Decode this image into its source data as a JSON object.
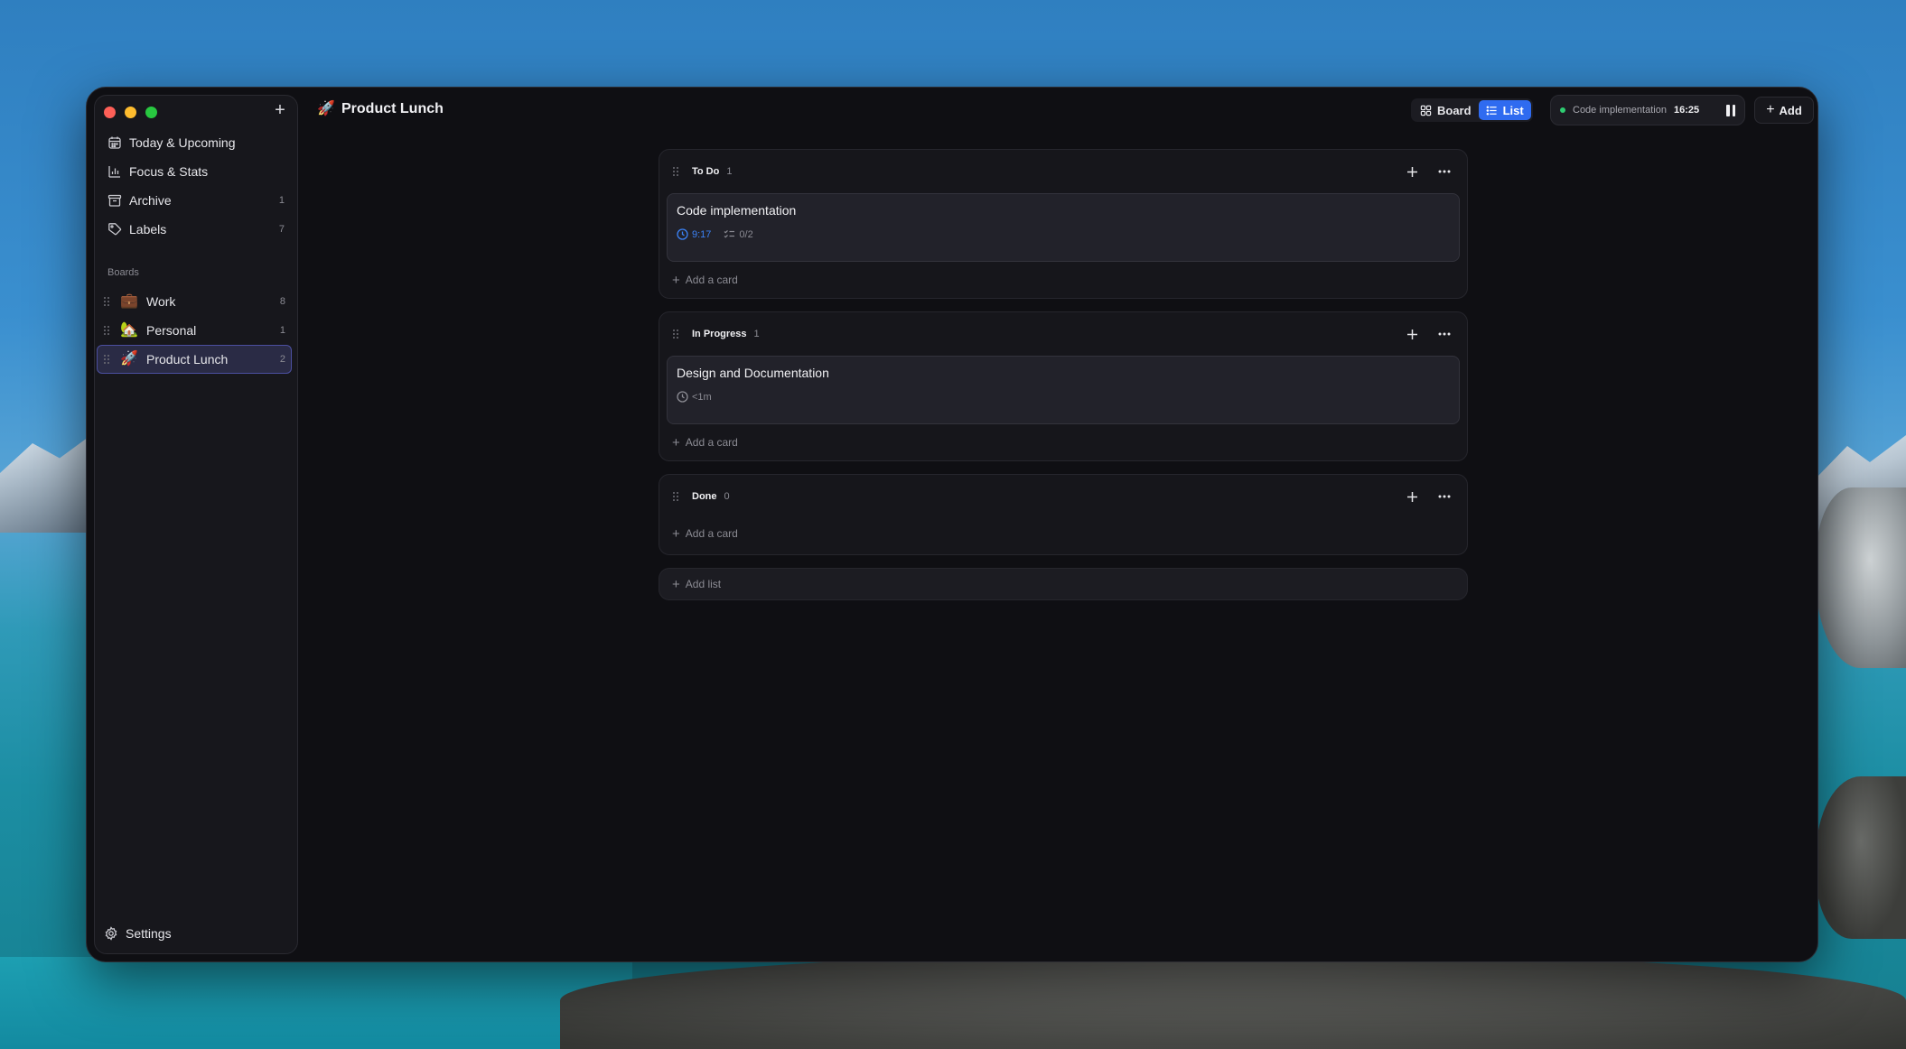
{
  "window": {
    "title": "Product Lunch",
    "title_emoji": "🚀"
  },
  "sidebar": {
    "nav": [
      {
        "label": "Today & Upcoming",
        "icon": "calendar-icon",
        "count": ""
      },
      {
        "label": "Focus & Stats",
        "icon": "chart-icon",
        "count": ""
      },
      {
        "label": "Archive",
        "icon": "archive-icon",
        "count": "1"
      },
      {
        "label": "Labels",
        "icon": "tag-icon",
        "count": "7"
      }
    ],
    "boards_title": "Boards",
    "boards": [
      {
        "label": "Work",
        "emoji": "💼",
        "count": "8"
      },
      {
        "label": "Personal",
        "emoji": "🏡",
        "count": "1"
      },
      {
        "label": "Product Lunch",
        "emoji": "🚀",
        "count": "2",
        "active": true
      }
    ],
    "settings_label": "Settings"
  },
  "header": {
    "view_board": "Board",
    "view_list": "List",
    "active_view": "List",
    "timer_task": "Code implementation",
    "timer_time": "16:25",
    "add_label": "Add"
  },
  "lists": [
    {
      "name": "To Do",
      "count": "1",
      "cards": [
        {
          "title": "Code implementation",
          "time": "9:17",
          "checklist": "0/2"
        }
      ],
      "add_card": "Add a card"
    },
    {
      "name": "In Progress",
      "count": "1",
      "cards": [
        {
          "title": "Design and Documentation",
          "time": "<1m"
        }
      ],
      "add_card": "Add a card"
    },
    {
      "name": "Done",
      "count": "0",
      "cards": [],
      "add_card": "Add a card"
    }
  ],
  "add_list_label": "Add list",
  "colors": {
    "accent": "#2f6bf0",
    "timer_blue": "#3b82f6",
    "running_dot": "#2ecc71"
  }
}
